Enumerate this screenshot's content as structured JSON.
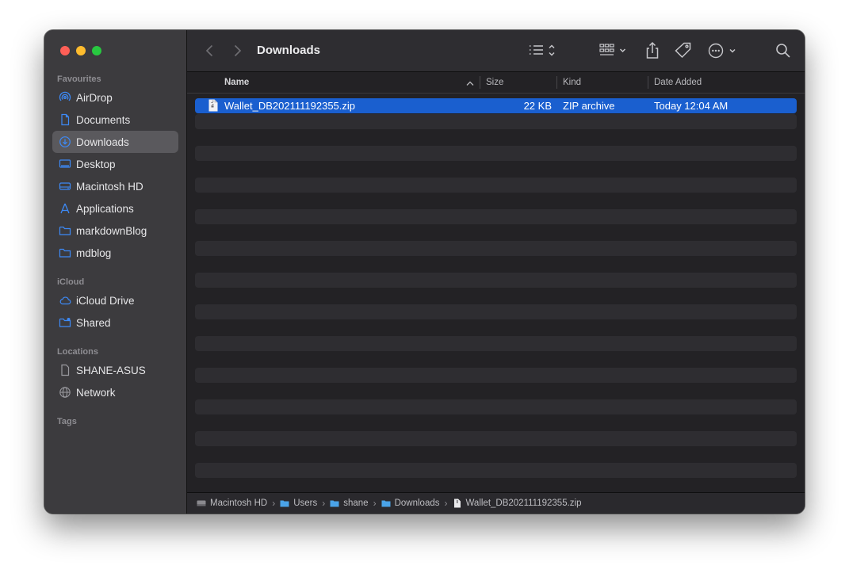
{
  "window": {
    "title": "Downloads"
  },
  "sidebar": {
    "sections": [
      {
        "title": "Favourites",
        "items": [
          {
            "label": "AirDrop",
            "icon": "airdrop-icon"
          },
          {
            "label": "Documents",
            "icon": "document-icon"
          },
          {
            "label": "Downloads",
            "icon": "download-icon",
            "active": true
          },
          {
            "label": "Desktop",
            "icon": "desktop-icon"
          },
          {
            "label": "Macintosh HD",
            "icon": "harddrive-icon"
          },
          {
            "label": "Applications",
            "icon": "applications-icon"
          },
          {
            "label": "markdownBlog",
            "icon": "folder-icon"
          },
          {
            "label": "mdblog",
            "icon": "folder-icon"
          }
        ]
      },
      {
        "title": "iCloud",
        "items": [
          {
            "label": "iCloud Drive",
            "icon": "cloud-icon"
          },
          {
            "label": "Shared",
            "icon": "shared-folder-icon"
          }
        ]
      },
      {
        "title": "Locations",
        "items": [
          {
            "label": "SHANE-ASUS",
            "icon": "computer-icon"
          },
          {
            "label": "Network",
            "icon": "globe-icon"
          }
        ]
      },
      {
        "title": "Tags",
        "items": []
      }
    ]
  },
  "columns": {
    "name": "Name",
    "size": "Size",
    "kind": "Kind",
    "date": "Date Added"
  },
  "files": [
    {
      "name": "Wallet_DB202111192355.zip",
      "size": "22 KB",
      "kind": "ZIP archive",
      "date": "Today 12:04 AM",
      "selected": true
    }
  ],
  "pathbar": [
    "Macintosh HD",
    "Users",
    "shane",
    "Downloads",
    "Wallet_DB202111192355.zip"
  ],
  "colors": {
    "selection": "#1a5fcf",
    "accent": "#3d8af7"
  }
}
